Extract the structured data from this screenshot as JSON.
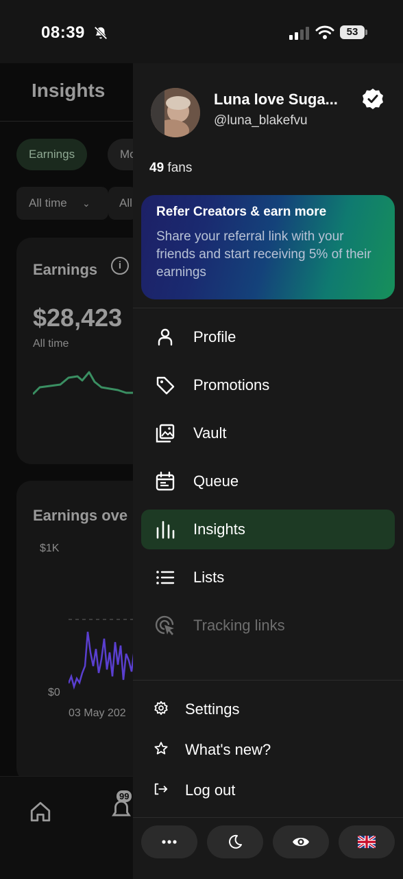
{
  "status_bar": {
    "time": "08:39",
    "battery": "53"
  },
  "background": {
    "title": "Insights",
    "chips": [
      "Earnings",
      "Mo"
    ],
    "selects": [
      "All time",
      "All"
    ],
    "earnings_card": {
      "title": "Earnings",
      "amount": "$28,423",
      "period": "All time"
    },
    "chart_card": {
      "title": "Earnings ove",
      "y_top": "$1K",
      "y_bottom": "$0",
      "x_start": "03 May 202"
    },
    "notification_badge": "99"
  },
  "drawer": {
    "profile": {
      "name": "Luna love Suga...",
      "handle": "@luna_blakefvu",
      "fans_count": "49",
      "fans_label": "fans"
    },
    "refer": {
      "title": "Refer Creators & earn more",
      "body": "Share your referral link with your friends and start receiving 5% of their earnings"
    },
    "menu": [
      {
        "label": "Profile",
        "icon": "user-icon"
      },
      {
        "label": "Promotions",
        "icon": "tag-icon"
      },
      {
        "label": "Vault",
        "icon": "images-icon"
      },
      {
        "label": "Queue",
        "icon": "calendar-icon"
      },
      {
        "label": "Insights",
        "icon": "bar-chart-icon",
        "active": true
      },
      {
        "label": "Lists",
        "icon": "list-icon"
      },
      {
        "label": "Tracking links",
        "icon": "cursor-click-icon",
        "disabled": true
      }
    ],
    "footer": [
      {
        "label": "Settings",
        "icon": "gear-icon"
      },
      {
        "label": "What's new?",
        "icon": "star-icon"
      },
      {
        "label": "Log out",
        "icon": "logout-icon"
      }
    ],
    "bottom_buttons": [
      "more-icon",
      "moon-icon",
      "eye-icon",
      "uk-flag-icon"
    ]
  },
  "colors": {
    "accent_active": "#1d3a24",
    "chart_line": "#3a8f62",
    "chart_bars": "#5a3fd0"
  }
}
